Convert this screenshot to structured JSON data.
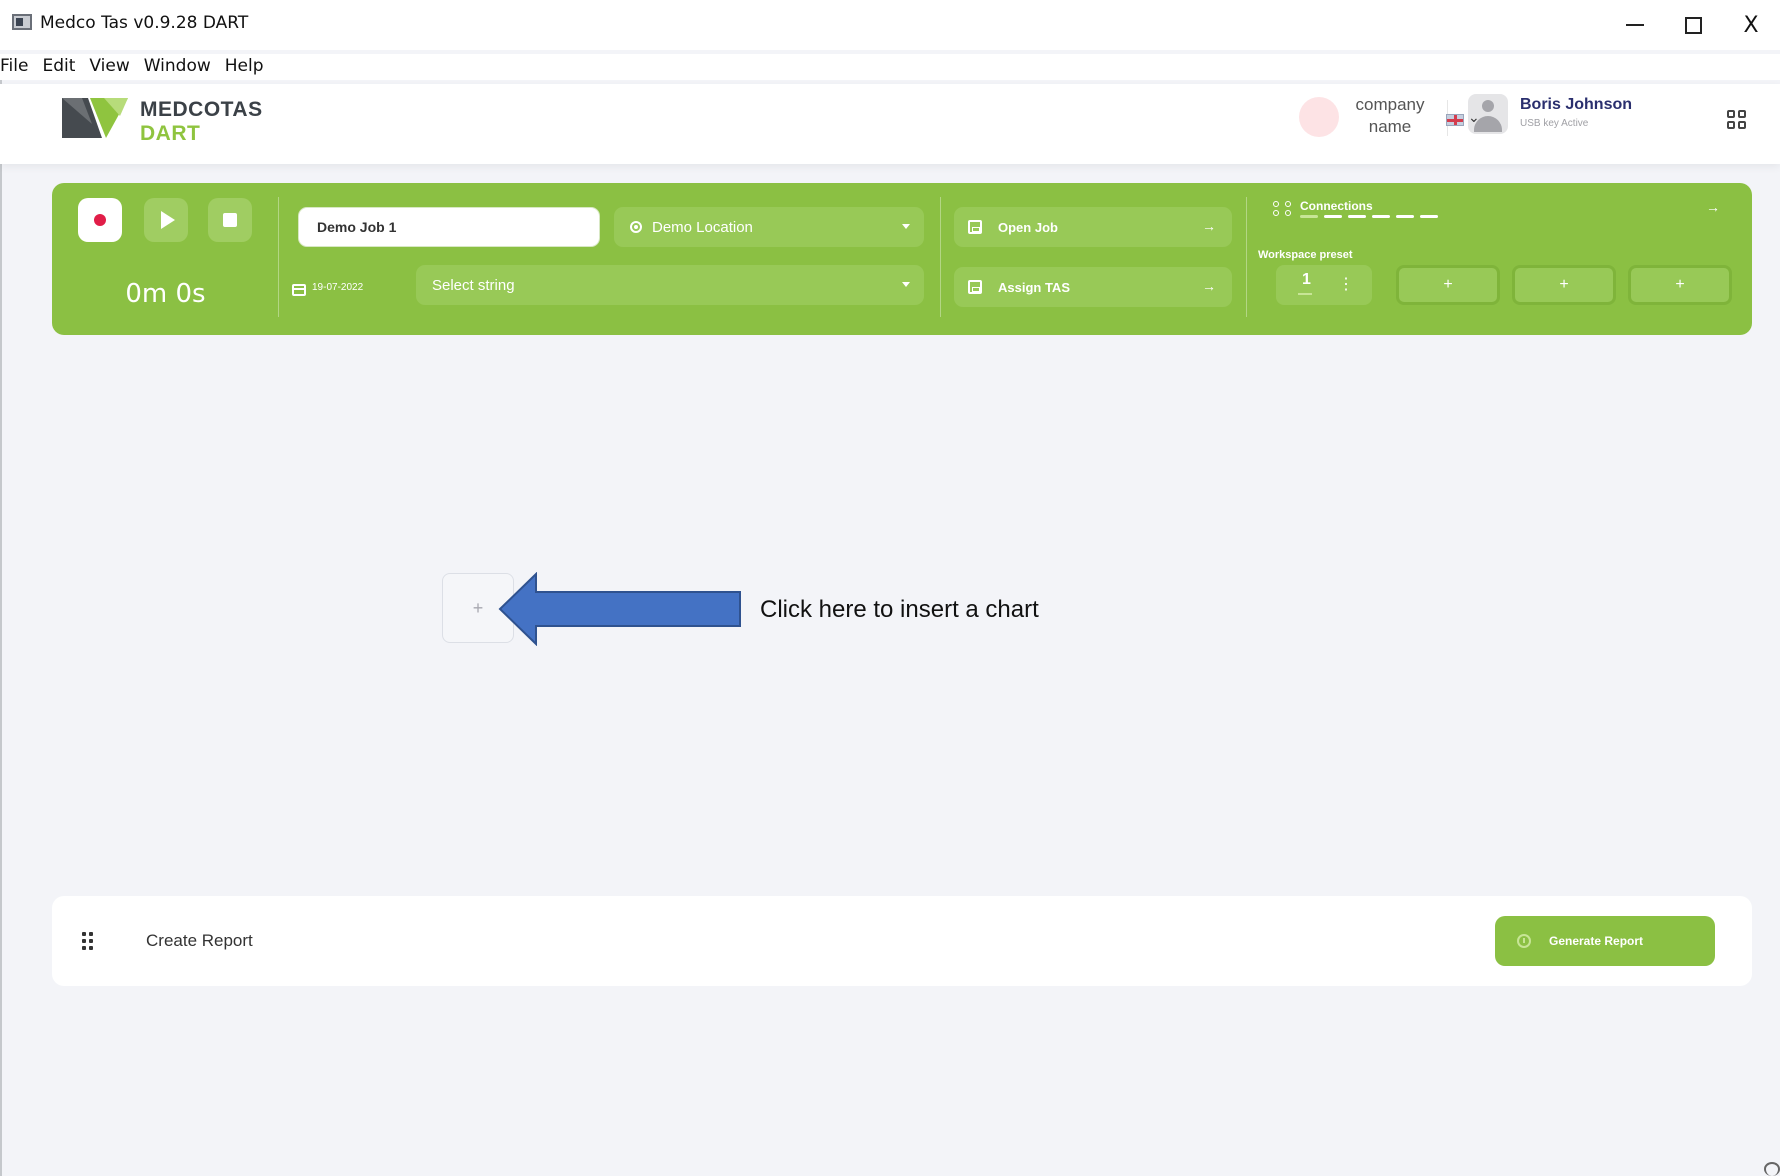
{
  "window": {
    "title": "Medco Tas v0.9.28  DART",
    "minimize": "minimize",
    "maximize": "maximize",
    "close": "X"
  },
  "menu": [
    "File",
    "Edit",
    "View",
    "Window",
    "Help"
  ],
  "header": {
    "logo_line1": "MEDCOTAS",
    "logo_line2": "DART",
    "company_line1": "company",
    "company_line2": "name",
    "user_name": "Boris Johnson",
    "user_status": "USB key Active",
    "language_flag": "uk-flag-icon"
  },
  "panel": {
    "timer": "0m 0s",
    "job_name": "Demo Job 1",
    "location": "Demo Location",
    "date": "19-07-2022",
    "string_placeholder": "Select string",
    "open_job_label": "Open Job",
    "assign_tas_label": "Assign TAS",
    "connections_label": "Connections",
    "workspace_preset_label": "Workspace preset",
    "preset_current": "1",
    "preset_add": "+"
  },
  "main": {
    "add_chart_symbol": "+",
    "callout_text": "Click here to insert a chart"
  },
  "report": {
    "label": "Create Report",
    "generate_label": "Generate Report"
  },
  "colors": {
    "brand_green": "#8bc043",
    "field_green": "#98c957",
    "record_red": "#e11d48",
    "callout_blue": "#4472c4",
    "user_name_navy": "#2a2f6e"
  }
}
